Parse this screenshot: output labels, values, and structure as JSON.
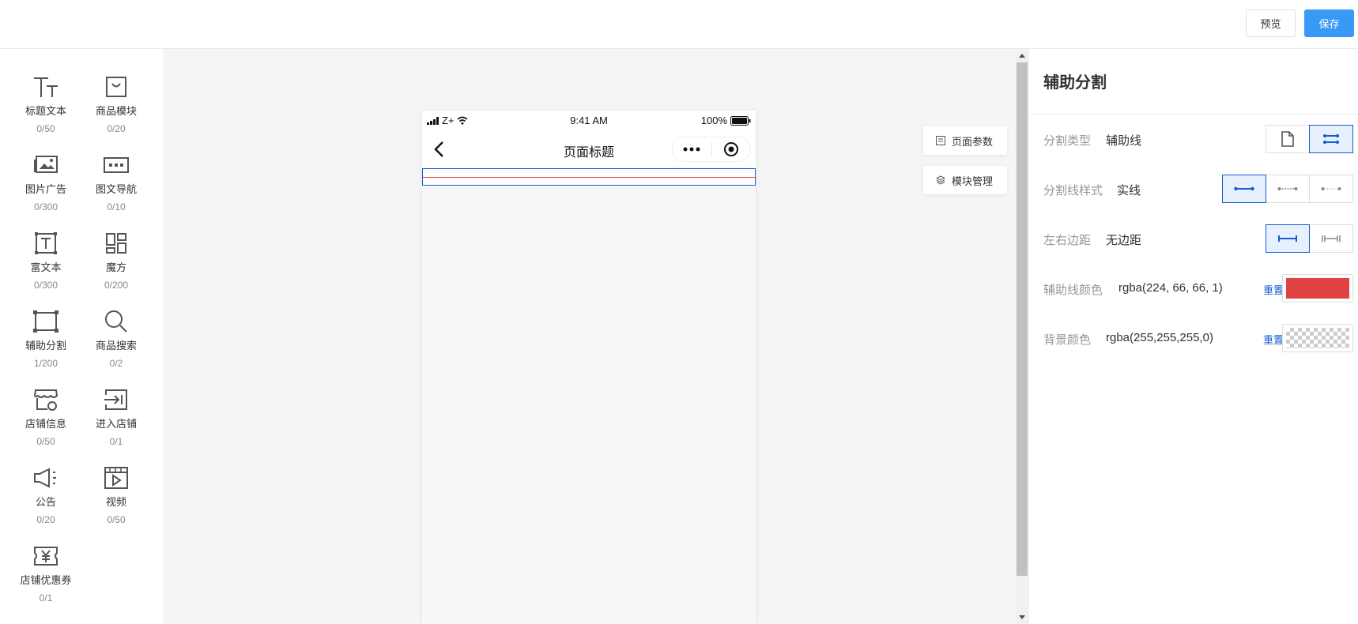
{
  "toolbar": {
    "preview_label": "预览",
    "save_label": "保存"
  },
  "components": [
    {
      "icon": "title-text-icon",
      "name": "标题文本",
      "count": "0/50"
    },
    {
      "icon": "product-module-icon",
      "name": "商品模块",
      "count": "0/20"
    },
    {
      "icon": "image-ad-icon",
      "name": "图片广告",
      "count": "0/300"
    },
    {
      "icon": "image-nav-icon",
      "name": "图文导航",
      "count": "0/10"
    },
    {
      "icon": "rich-text-icon",
      "name": "富文本",
      "count": "0/300"
    },
    {
      "icon": "magic-cube-icon",
      "name": "魔方",
      "count": "0/200"
    },
    {
      "icon": "divider-icon",
      "name": "辅助分割",
      "count": "1/200"
    },
    {
      "icon": "product-search-icon",
      "name": "商品搜索",
      "count": "0/2"
    },
    {
      "icon": "store-info-icon",
      "name": "店铺信息",
      "count": "0/50"
    },
    {
      "icon": "enter-store-icon",
      "name": "进入店铺",
      "count": "0/1"
    },
    {
      "icon": "announcement-icon",
      "name": "公告",
      "count": "0/20"
    },
    {
      "icon": "video-icon",
      "name": "视频",
      "count": "0/50"
    },
    {
      "icon": "coupon-icon",
      "name": "店铺优惠券",
      "count": "0/1"
    }
  ],
  "phone": {
    "carrier": "Z+",
    "time": "9:41 AM",
    "battery": "100%",
    "page_title": "页面标题",
    "divider_color": "#e04242"
  },
  "side_buttons": {
    "page_params": "页面参数",
    "module_manage": "模块管理"
  },
  "panel": {
    "title": "辅助分割",
    "divider_type": {
      "label": "分割类型",
      "value": "辅助线"
    },
    "line_style": {
      "label": "分割线样式",
      "value": "实线"
    },
    "padding": {
      "label": "左右边距",
      "value": "无边距"
    },
    "line_color": {
      "label": "辅助线颜色",
      "value": "rgba(224, 66, 66, 1)",
      "reset": "重置",
      "swatch": "#e04242"
    },
    "bg_color": {
      "label": "背景颜色",
      "value": "rgba(255,255,255,0)",
      "reset": "重置"
    }
  },
  "colors": {
    "accent": "#155bd4",
    "primary_button": "#3899f7"
  }
}
